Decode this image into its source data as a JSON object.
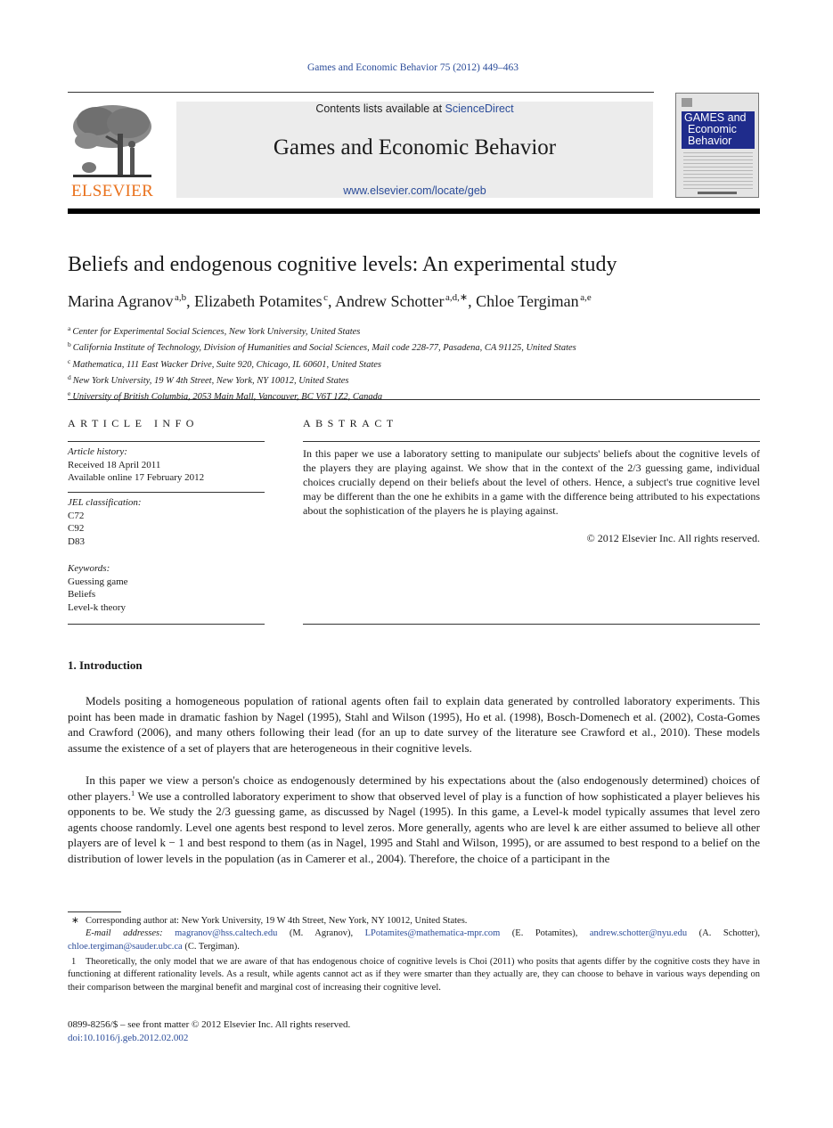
{
  "citation": "Games and Economic Behavior 75 (2012) 449–463",
  "header": {
    "publisher_logo_text": "ELSEVIER",
    "contents_prefix": "Contents lists available at ",
    "contents_link": "ScienceDirect",
    "journal_title": "Games and Economic Behavior",
    "journal_url": "www.elsevier.com/locate/geb",
    "cover": {
      "line1": "GAMES and",
      "line2": "Economic",
      "line3": "Behavior"
    }
  },
  "article": {
    "title": "Beliefs and endogenous cognitive levels: An experimental study",
    "authors": [
      {
        "name": "Marina Agranov",
        "sup": "a,b",
        "sep": ", "
      },
      {
        "name": "Elizabeth Potamites",
        "sup": "c",
        "sep": ", "
      },
      {
        "name": "Andrew Schotter",
        "sup": "a,d,∗",
        "sep": ", "
      },
      {
        "name": "Chloe Tergiman",
        "sup": "a,e",
        "sep": ""
      }
    ],
    "affiliations": [
      {
        "key": "a",
        "text": "Center for Experimental Social Sciences, New York University, United States"
      },
      {
        "key": "b",
        "text": "California Institute of Technology, Division of Humanities and Social Sciences, Mail code 228-77, Pasadena, CA 91125, United States"
      },
      {
        "key": "c",
        "text": "Mathematica, 111 East Wacker Drive, Suite 920, Chicago, IL 60601, United States"
      },
      {
        "key": "d",
        "text": "New York University, 19 W 4th Street, New York, NY 10012, United States"
      },
      {
        "key": "e",
        "text": "University of British Columbia, 2053 Main Mall, Vancouver, BC V6T 1Z2, Canada"
      }
    ]
  },
  "article_info": {
    "heading": "ARTICLE INFO",
    "history_label": "Article history:",
    "received": "Received 18 April 2011",
    "available": "Available online 17 February 2012",
    "jel_label": "JEL classification:",
    "jel": [
      "C72",
      "C92",
      "D83"
    ],
    "keywords_label": "Keywords:",
    "keywords": [
      "Guessing game",
      "Beliefs",
      "Level-k theory"
    ]
  },
  "abstract": {
    "heading": "ABSTRACT",
    "text": "In this paper we use a laboratory setting to manipulate our subjects' beliefs about the cognitive levels of the players they are playing against. We show that in the context of the 2/3 guessing game, individual choices crucially depend on their beliefs about the level of others. Hence, a subject's true cognitive level may be different than the one he exhibits in a game with the difference being attributed to his expectations about the sophistication of the players he is playing against.",
    "copyright": "© 2012 Elsevier Inc. All rights reserved."
  },
  "introduction": {
    "heading": "1. Introduction",
    "para1": "Models positing a homogeneous population of rational agents often fail to explain data generated by controlled laboratory experiments. This point has been made in dramatic fashion by Nagel (1995), Stahl and Wilson (1995), Ho et al. (1998), Bosch-Domenech et al. (2002), Costa-Gomes and Crawford (2006), and many others following their lead (for an up to date survey of the literature see Crawford et al., 2010). These models assume the existence of a set of players that are heterogeneous in their cognitive levels.",
    "para2_a": "In this paper we view a person's choice as endogenously determined by his expectations about the (also endogenously determined) choices of other players.",
    "para2_fn": "1",
    "para2_b": " We use a controlled laboratory experiment to show that observed level of play is a function of how sophisticated a player believes his opponents to be. We study the 2/3 guessing game, as discussed by Nagel (1995). In this game, a Level-k model typically assumes that level zero agents choose randomly. Level one agents best respond to level zeros. More generally, agents who are level k are either assumed to believe all other players are of level k − 1 and best respond to them (as in Nagel, 1995 and Stahl and Wilson, 1995), or are assumed to best respond to a belief on the distribution of lower levels in the population (as in Camerer et al., 2004). Therefore, the choice of a participant in the"
  },
  "footnotes": {
    "corr_mark": "∗",
    "corr_text": "Corresponding author at: New York University, 19 W 4th Street, New York, NY 10012, United States.",
    "email_label": "E-mail addresses:",
    "emails": [
      {
        "addr": "magranov@hss.caltech.edu",
        "who": " (M. Agranov), "
      },
      {
        "addr": "LPotamites@mathematica-mpr.com",
        "who": " (E. Potamites), "
      },
      {
        "addr": "andrew.schotter@nyu.edu",
        "who": " (A. Schotter), "
      },
      {
        "addr": "chloe.tergiman@sauder.ubc.ca",
        "who": " (C. Tergiman)."
      }
    ],
    "fn1_mark": "1",
    "fn1_text": "Theoretically, the only model that we are aware of that has endogenous choice of cognitive levels is Choi (2011) who posits that agents differ by the cognitive costs they have in functioning at different rationality levels. As a result, while agents cannot act as if they were smarter than they actually are, they can choose to behave in various ways depending on their comparison between the marginal benefit and marginal cost of increasing their cognitive level."
  },
  "bottom": {
    "issn": "0899-8256/$ – see front matter  © 2012 Elsevier Inc. All rights reserved.",
    "doi": "doi:10.1016/j.geb.2012.02.002"
  }
}
